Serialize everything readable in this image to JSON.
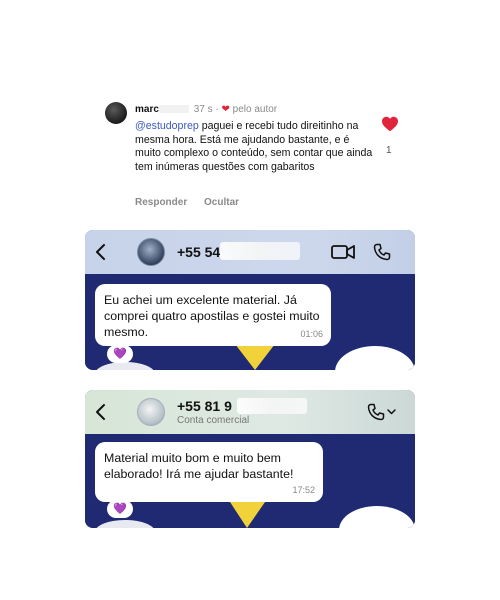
{
  "comment": {
    "username": "marc",
    "time": "37 s",
    "author_badge": "pelo autor",
    "mention": "@estudoprep",
    "text": " paguei e recebi tudo direitinho na mesma hora. Está me ajudando bastante, e é muito complexo o conteúdo, sem contar que ainda tem inúmeras questões com gabaritos",
    "actions": [
      "Responder",
      "Ocultar"
    ],
    "like_count": "1",
    "like_color": "#e0243b"
  },
  "chats": [
    {
      "phone": "+55 54",
      "subtitle": "",
      "message": "Eu achei um excelente material. Já comprei quatro apostilas e gostei muito mesmo.",
      "time": "01:06",
      "reaction": "💜",
      "icons": [
        "back-arrow-icon",
        "video-call-icon",
        "phone-call-icon"
      ]
    },
    {
      "phone": "+55 81 9",
      "subtitle": "Conta comercial",
      "message": "Material muito bom e muito bem elaborado! Irá me ajudar bastante!",
      "time": "17:52",
      "reaction": "💜",
      "icons": [
        "back-arrow-icon",
        "phone-call-menu-icon"
      ]
    }
  ],
  "colors": {
    "chat_background": "#1f2a72",
    "bubble": "#ffffff",
    "mention": "#3b5bbf",
    "wallpaper_accent": "#f2d23a"
  }
}
